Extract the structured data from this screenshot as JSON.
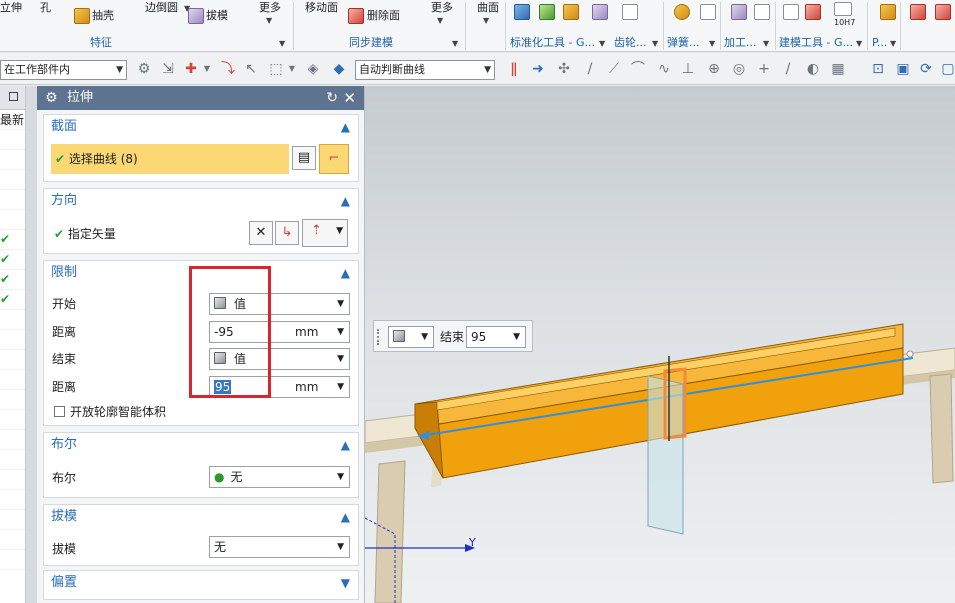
{
  "ribbon": {
    "top_left": [
      {
        "label": "立伸"
      },
      {
        "label": "孔"
      }
    ],
    "items": [
      {
        "label": "抽壳"
      },
      {
        "label": "边倒圆"
      },
      {
        "label": "拔模"
      },
      {
        "label": "更多"
      },
      {
        "label": "移动面"
      },
      {
        "label": "删除面"
      },
      {
        "label": "更多"
      },
      {
        "label": "曲面"
      }
    ],
    "icon_text": "10H7",
    "groups": [
      {
        "label": "特征"
      },
      {
        "label": "同步建模"
      },
      {
        "label": "标准化工具 - G..."
      },
      {
        "label": "齿轮..."
      },
      {
        "label": "弹簧..."
      },
      {
        "label": "加工..."
      },
      {
        "label": "建模工具 - G..."
      },
      {
        "label": "P..."
      }
    ]
  },
  "toolbar2": {
    "scope_select": "在工作部件内",
    "curve_rule": "自动判断曲线"
  },
  "leftnav": {
    "header_text": "最新"
  },
  "dialog": {
    "title": "拉伸",
    "sections": {
      "section": {
        "title": "截面",
        "select_curve": "选择曲线 (8)"
      },
      "direction": {
        "title": "方向",
        "specify_vector": "指定矢量"
      },
      "limits": {
        "title": "限制",
        "start_label": "开始",
        "start_value": "值",
        "start_distance_label": "距离",
        "start_distance": "-95",
        "start_unit": "mm",
        "end_label": "结束",
        "end_value": "值",
        "end_distance_label": "距离",
        "end_distance": "95",
        "end_unit": "mm",
        "open_profile": "开放轮廓智能体积"
      },
      "boolean": {
        "title": "布尔",
        "label": "布尔",
        "value": "无"
      },
      "draft": {
        "title": "拔模",
        "label": "拔模",
        "value": "无"
      },
      "offset": {
        "title": "偏置"
      }
    }
  },
  "viewport": {
    "float_label": "结束",
    "float_value": "95",
    "axis_label": "Y"
  },
  "colors": {
    "title_bar": "#5d7390",
    "section_header": "#2a6fb5",
    "highlight": "#d9262c",
    "selected_row": "#fcd874",
    "extrusion": "#f0a10c"
  }
}
